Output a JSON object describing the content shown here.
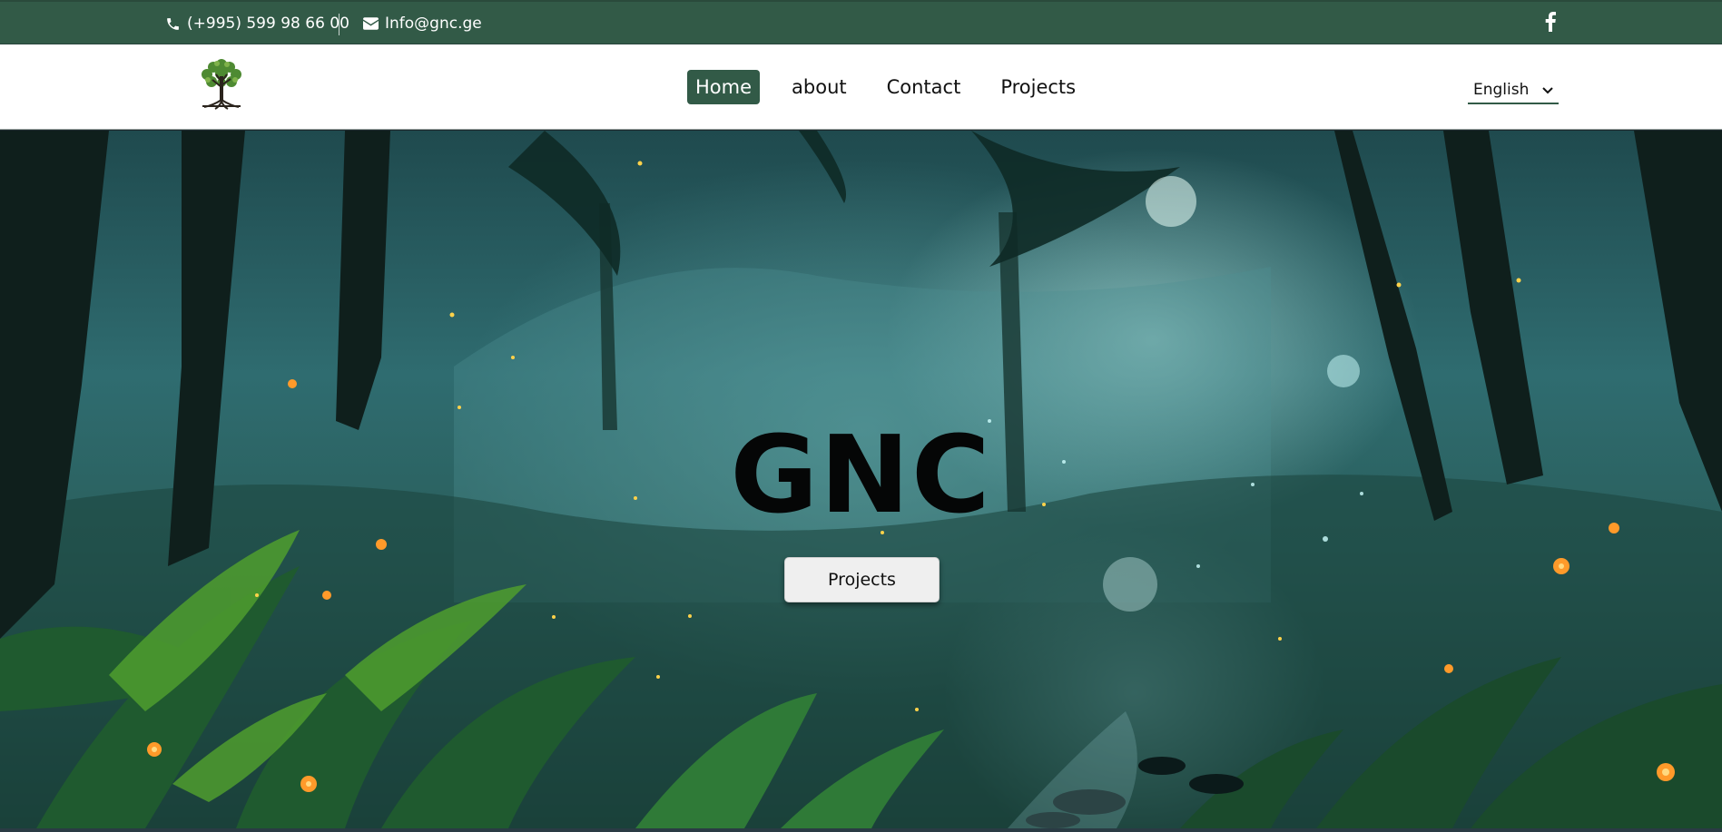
{
  "topbar": {
    "phone": "(+995) 599 98 66 00",
    "email": "Info@gnc.ge",
    "phone_icon": "phone-icon",
    "email_icon": "envelope-icon",
    "social_icon": "facebook-icon"
  },
  "header": {
    "logo_icon": "tree-logo-icon",
    "nav": [
      {
        "label": "Home",
        "active": true
      },
      {
        "label": "about",
        "active": false
      },
      {
        "label": "Contact",
        "active": false
      },
      {
        "label": "Projects",
        "active": false
      }
    ],
    "language": {
      "selected": "English",
      "icon": "chevron-down-icon"
    }
  },
  "hero": {
    "title": "GNC",
    "button_label": "Projects"
  },
  "colors": {
    "brand_green": "#325a47",
    "header_bg": "#ffffff",
    "hero_title": "#050606",
    "button_bg": "#efefef"
  }
}
